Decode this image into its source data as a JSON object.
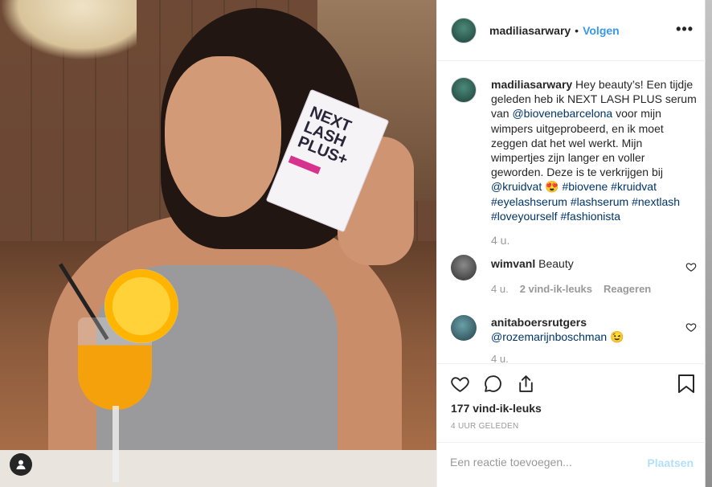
{
  "post": {
    "username": "madiliasarwary",
    "separator": "•",
    "follow_label": "Volgen",
    "more_label": "•••"
  },
  "photo": {
    "box_brand": "NEXT LASH PLUS+",
    "profile_icon": "user-icon"
  },
  "caption": {
    "username": "madiliasarwary",
    "part1": " Hey beauty’s! Een tijdje geleden heb ik NEXT LASH PLUS serum van ",
    "mention1": "@biovenebarcelona",
    "part2": " voor mijn wimpers uitgeprobeerd, en ik moet zeggen dat het wel werkt. Mijn wimpertjes zijn langer en voller geworden. Deze is te verkrijgen bij ",
    "mention2": "@kruidvat",
    "emoji": " 😍 ",
    "tags": "#biovene #kruidvat #eyelashserum #lashserum #nextlash #loveyourself #fashionista",
    "time": "4 u."
  },
  "comments": [
    {
      "username": "wimvanl",
      "text": " Beauty",
      "time": "4 u.",
      "likes": "2 vind-ik-leuks",
      "reply": "Reageren"
    },
    {
      "username": "anitaboersrutgers",
      "mention": "@rozemarijnboschman",
      "emoji": " 😉",
      "time": "4 u."
    }
  ],
  "actions": {
    "likes_count": "177 vind-ik-leuks",
    "posted_ago": "4 UUR GELEDEN"
  },
  "add_comment": {
    "placeholder": "Een reactie toevoegen...",
    "post_label": "Plaatsen"
  },
  "colors": {
    "link": "#3897f0",
    "mention": "#003569",
    "muted": "#999999",
    "post_disabled": "#b2dffc"
  }
}
